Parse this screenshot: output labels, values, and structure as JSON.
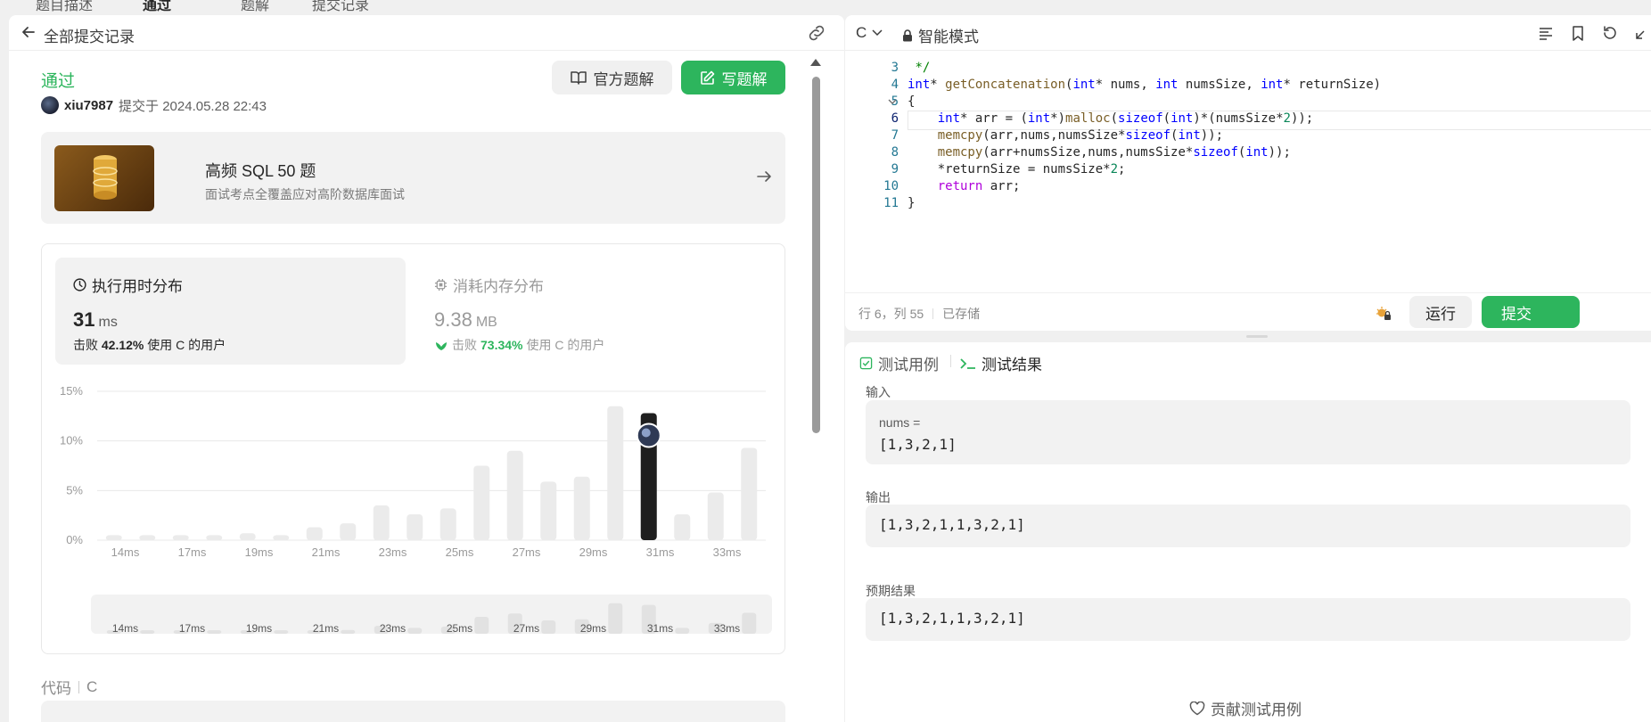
{
  "top_tabs": [
    "题目描述",
    "通过",
    "题解",
    "提交记录"
  ],
  "left": {
    "header_title": "全部提交记录",
    "status": "通过",
    "username": "xiu7987",
    "submitted_at": "提交于 2024.05.28 22:43",
    "btn_official": "官方题解",
    "btn_write": "写题解",
    "promo_title": "高频 SQL 50 题",
    "promo_subtitle": "面试考点全覆盖应对高阶数据库面试",
    "runtime_label": "执行用时分布",
    "runtime_value": "31",
    "runtime_unit": "ms",
    "runtime_beats_prefix": "击败",
    "runtime_beats_pct": "42.12%",
    "runtime_beats_suffix": "使用 C 的用户",
    "memory_label": "消耗内存分布",
    "memory_value": "9.38",
    "memory_unit": "MB",
    "memory_beats_prefix": "击败",
    "memory_beats_pct": "73.34%",
    "memory_beats_suffix": "使用 C 的用户",
    "code_label": "代码",
    "code_lang": "C"
  },
  "chart_data": {
    "type": "bar",
    "title": "",
    "xlabel": "",
    "ylabel": "",
    "ylim": [
      0,
      15
    ],
    "y_ticks": [
      "15%",
      "10%",
      "5%",
      "0%"
    ],
    "x_tick_labels": [
      "14ms",
      "17ms",
      "19ms",
      "21ms",
      "23ms",
      "25ms",
      "27ms",
      "29ms",
      "31ms",
      "33ms"
    ],
    "values": [
      0.5,
      0.5,
      0.5,
      0.5,
      0.7,
      0.5,
      1.3,
      1.7,
      3.5,
      2.6,
      3.2,
      7.5,
      9.0,
      5.9,
      6.4,
      13.5,
      12.8,
      2.6,
      4.8,
      9.3
    ],
    "highlight_index": 16,
    "bar_color": "#ebebeb",
    "highlight_color": "#1f1f1f"
  },
  "editor": {
    "language": "C",
    "mode": "智能模式",
    "lines": [
      {
        "n": "3",
        "html": " <span class='cm'>*/</span>"
      },
      {
        "n": "4",
        "html": "<span class='ty'>int</span>* <span class='fn'>getConcatenation</span>(<span class='ty'>int</span>* nums, <span class='ty'>int</span> numsSize, <span class='ty'>int</span>* returnSize)"
      },
      {
        "n": "5",
        "html": "{"
      },
      {
        "n": "6",
        "html": "    <span class='ty'>int</span>* arr = (<span class='ty'>int</span>*)<span class='fn'>malloc</span>(<span class='kw'>sizeof</span>(<span class='ty'>int</span>)*(numsSize*<span class='num'>2</span>));"
      },
      {
        "n": "7",
        "html": "    <span class='fn'>memcpy</span>(arr,nums,numsSize*<span class='kw'>sizeof</span>(<span class='ty'>int</span>));"
      },
      {
        "n": "8",
        "html": "    <span class='fn'>memcpy</span>(arr+numsSize,nums,numsSize*<span class='kw'>sizeof</span>(<span class='ty'>int</span>));"
      },
      {
        "n": "9",
        "html": "    *returnSize = numsSize*<span class='num'>2</span>;"
      },
      {
        "n": "10",
        "html": "    <span class='ctrl'>return</span> arr;"
      },
      {
        "n": "11",
        "html": "}"
      }
    ],
    "cursor_pos": "行 6，列 55",
    "saved": "已存储",
    "btn_run": "运行",
    "btn_submit": "提交"
  },
  "tests": {
    "tab_cases": "测试用例",
    "tab_result": "测试结果",
    "input_label": "输入",
    "input_name": "nums =",
    "input_value": "[1,3,2,1]",
    "output_label": "输出",
    "output_value": "[1,3,2,1,1,3,2,1]",
    "expected_label": "预期结果",
    "expected_value": "[1,3,2,1,1,3,2,1]",
    "contribute": "贡献测试用例"
  }
}
